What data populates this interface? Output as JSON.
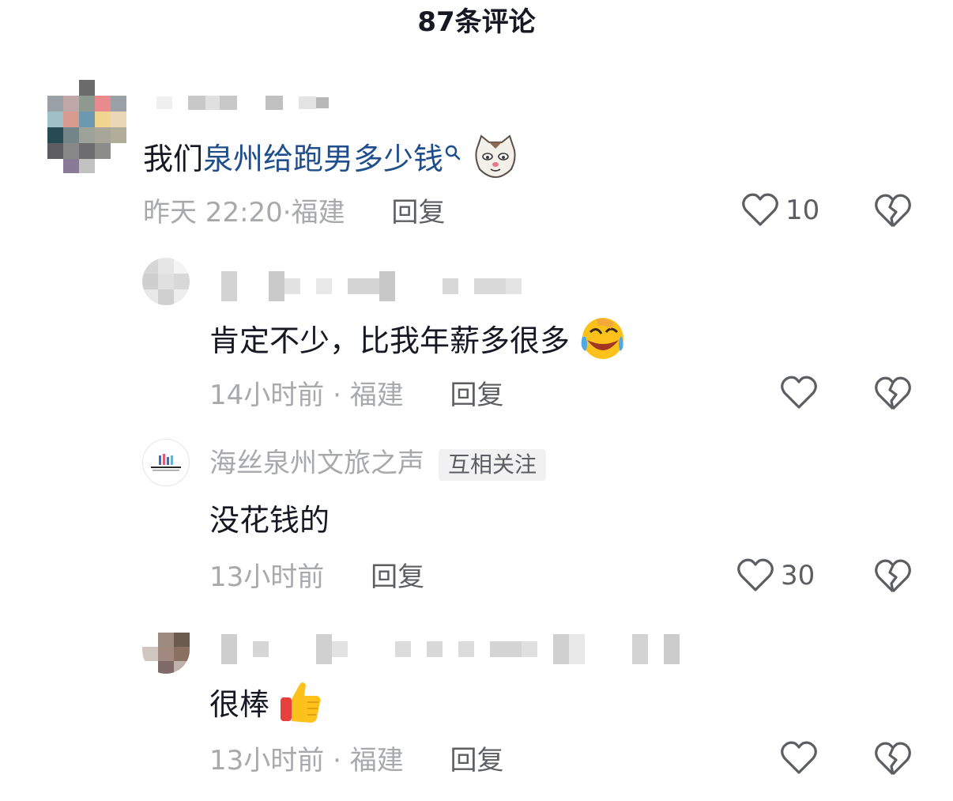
{
  "header": {
    "title": "87条评论"
  },
  "comments": [
    {
      "text_plain": "我们",
      "text_link": "泉州给跑男多少钱",
      "time": "昨天 22:20",
      "sep": "·",
      "location": "福建",
      "reply_label": "回复",
      "likes": "10"
    },
    {
      "text": "肯定不少，比我年薪多很多",
      "time": "14小时前",
      "sep": "·",
      "location": "福建",
      "reply_label": "回复"
    },
    {
      "author": "海丝泉州文旅之声",
      "tag": "互相关注",
      "text": "没花钱的",
      "time": "13小时前",
      "reply_label": "回复",
      "likes": "30"
    },
    {
      "text": "很棒",
      "time": "13小时前",
      "sep": "·",
      "location": "福建",
      "reply_label": "回复"
    }
  ],
  "icons": {
    "like": "heart-outline-icon",
    "dislike": "broken-heart-icon",
    "search": "search-icon"
  },
  "colors": {
    "link": "#1f4e8c",
    "meta": "#a8a9ad",
    "text": "#161823"
  }
}
